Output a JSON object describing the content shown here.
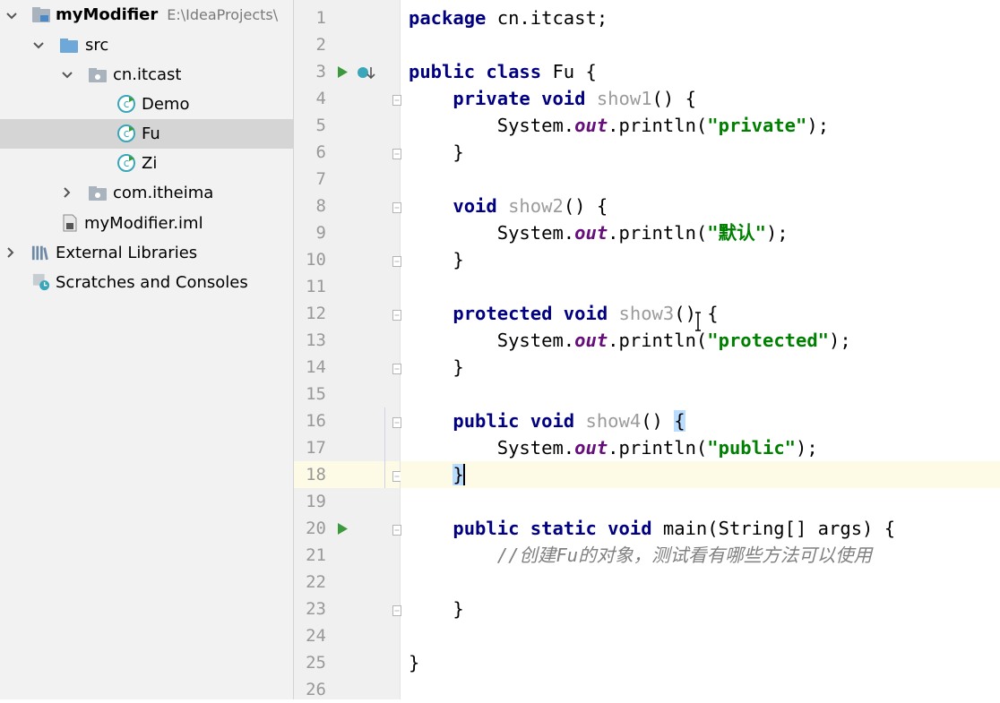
{
  "project_tree": {
    "items": [
      {
        "label": "myModifier",
        "path": "E:\\IdeaProjects\\"
      },
      {
        "label": "src"
      },
      {
        "label": "cn.itcast"
      },
      {
        "label": "Demo"
      },
      {
        "label": "Fu"
      },
      {
        "label": "Zi"
      },
      {
        "label": "com.itheima"
      },
      {
        "label": "myModifier.iml"
      },
      {
        "label": "External Libraries"
      },
      {
        "label": "Scratches and Consoles"
      }
    ],
    "selected_item": "Fu"
  },
  "editor": {
    "line_numbers": [
      "1",
      "2",
      "3",
      "4",
      "5",
      "6",
      "7",
      "8",
      "9",
      "10",
      "11",
      "12",
      "13",
      "14",
      "15",
      "16",
      "17",
      "18",
      "19",
      "20",
      "21",
      "22",
      "23",
      "24",
      "25",
      "26"
    ],
    "lines": [
      [
        {
          "t": "package",
          "c": "kw"
        },
        {
          "t": " cn.itcast;"
        }
      ],
      [],
      [
        {
          "t": "public class",
          "c": "kw"
        },
        {
          "t": " Fu {"
        }
      ],
      [
        {
          "t": "    "
        },
        {
          "t": "private void",
          "c": "kw"
        },
        {
          "t": " "
        },
        {
          "t": "show1",
          "c": "gray"
        },
        {
          "t": "() {"
        }
      ],
      [
        {
          "t": "        System."
        },
        {
          "t": "out",
          "c": "ital"
        },
        {
          "t": ".println("
        },
        {
          "t": "\"private\"",
          "c": "str"
        },
        {
          "t": ");"
        }
      ],
      [
        {
          "t": "    }"
        }
      ],
      [],
      [
        {
          "t": "    "
        },
        {
          "t": "void",
          "c": "kw"
        },
        {
          "t": " "
        },
        {
          "t": "show2",
          "c": "gray"
        },
        {
          "t": "() {"
        }
      ],
      [
        {
          "t": "        System."
        },
        {
          "t": "out",
          "c": "ital"
        },
        {
          "t": ".println("
        },
        {
          "t": "\"默认\"",
          "c": "str"
        },
        {
          "t": ");"
        }
      ],
      [
        {
          "t": "    }"
        }
      ],
      [],
      [
        {
          "t": "    "
        },
        {
          "t": "protected void",
          "c": "kw"
        },
        {
          "t": " "
        },
        {
          "t": "show3",
          "c": "gray"
        },
        {
          "t": "() {"
        }
      ],
      [
        {
          "t": "        System."
        },
        {
          "t": "out",
          "c": "ital"
        },
        {
          "t": ".println("
        },
        {
          "t": "\"protected\"",
          "c": "str"
        },
        {
          "t": ");"
        }
      ],
      [
        {
          "t": "    }"
        }
      ],
      [],
      [
        {
          "t": "    "
        },
        {
          "t": "public void",
          "c": "kw"
        },
        {
          "t": " "
        },
        {
          "t": "show4",
          "c": "gray"
        },
        {
          "t": "() "
        },
        {
          "t": "{",
          "c": "bm"
        }
      ],
      [
        {
          "t": "        System."
        },
        {
          "t": "out",
          "c": "ital"
        },
        {
          "t": ".println("
        },
        {
          "t": "\"public\"",
          "c": "str"
        },
        {
          "t": ");"
        }
      ],
      [
        {
          "t": "    "
        },
        {
          "t": "}",
          "c": "bm"
        }
      ],
      [],
      [
        {
          "t": "    "
        },
        {
          "t": "public static void",
          "c": "kw"
        },
        {
          "t": " main(String[] args) {"
        }
      ],
      [
        {
          "t": "        "
        },
        {
          "t": "//创建",
          "c": "cmt"
        },
        {
          "t": "Fu",
          "c": "cmt"
        },
        {
          "t": "的对象，测试看有哪些方法可以使用",
          "c": "cmt"
        }
      ],
      [],
      [
        {
          "t": "    }"
        }
      ],
      [],
      [
        {
          "t": "}"
        }
      ],
      []
    ],
    "current_line": 18
  },
  "colors": {
    "keyword": "#000080",
    "string": "#008000",
    "static_field": "#660e7a",
    "unused_method": "#9b9b9b",
    "comment": "#808080",
    "current_line_bg": "#fdfbe5",
    "brace_match_bg": "#b9dcff",
    "run_icon": "#3c9a3c",
    "class_icon": "#3aa6b9"
  }
}
